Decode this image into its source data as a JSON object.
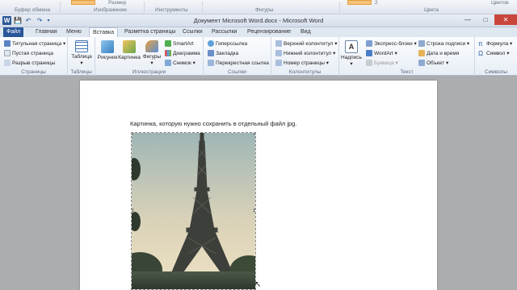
{
  "top_strip": {
    "groups": [
      "Буфер обмена",
      "Изображение",
      "Инструменты",
      "Фигуры",
      "Цвета"
    ],
    "fragments": [
      "Размер",
      "2",
      "Цветов"
    ]
  },
  "title": {
    "window_title": "Документ Microsoft Word.docx - Microsoft Word",
    "logo_letter": "W",
    "save_glyph": "💾",
    "undo_glyph": "↶",
    "redo_glyph": "↷",
    "minimize_glyph": "—",
    "maximize_glyph": "□",
    "close_glyph": "✕"
  },
  "tabs": [
    {
      "label": "Файл",
      "kind": "file"
    },
    {
      "label": "Главная",
      "kind": "normal"
    },
    {
      "label": "Меню",
      "kind": "normal"
    },
    {
      "label": "Вставка",
      "kind": "active"
    },
    {
      "label": "Разметка страницы",
      "kind": "normal"
    },
    {
      "label": "Ссылки",
      "kind": "normal"
    },
    {
      "label": "Рассылки",
      "kind": "normal"
    },
    {
      "label": "Рецензирование",
      "kind": "normal"
    },
    {
      "label": "Вид",
      "kind": "normal"
    }
  ],
  "ribbon": {
    "pages": {
      "group": "Страницы",
      "items": [
        "Титульная страница ▾",
        "Пустая страница",
        "Разрыв страницы"
      ]
    },
    "tables": {
      "group": "Таблицы",
      "button": "Таблица ▾"
    },
    "illustrations": {
      "group": "Иллюстрации",
      "buttons": [
        "Рисунок",
        "Картинка",
        "Фигуры ▾"
      ],
      "items": [
        "SmartArt",
        "Диаграмма",
        "Снимок ▾"
      ]
    },
    "links": {
      "group": "Ссылки",
      "items": [
        "Гиперссылка",
        "Закладка",
        "Перекрестная ссылка"
      ]
    },
    "headers": {
      "group": "Колонтитулы",
      "items": [
        "Верхний колонтитул ▾",
        "Нижний колонтитул ▾",
        "Номер страницы ▾"
      ]
    },
    "text": {
      "group": "Текст",
      "button": "Надпись ▾",
      "items": [
        "Экспресс-блоки ▾",
        "WordArt ▾",
        "Буквица ▾",
        "Строка подписи ▾",
        "Дата и время",
        "Объект ▾"
      ]
    },
    "symbols": {
      "group": "Символы",
      "items": [
        "Формула ▾",
        "Символ ▾"
      ]
    }
  },
  "document": {
    "caption": "Картинка, которую нужно сохранить в отдельный файл jpg."
  },
  "colors": {
    "file_tab": "#2a5699",
    "close_button": "#c9463d",
    "ribbon_bg": "#f3f6fa"
  }
}
